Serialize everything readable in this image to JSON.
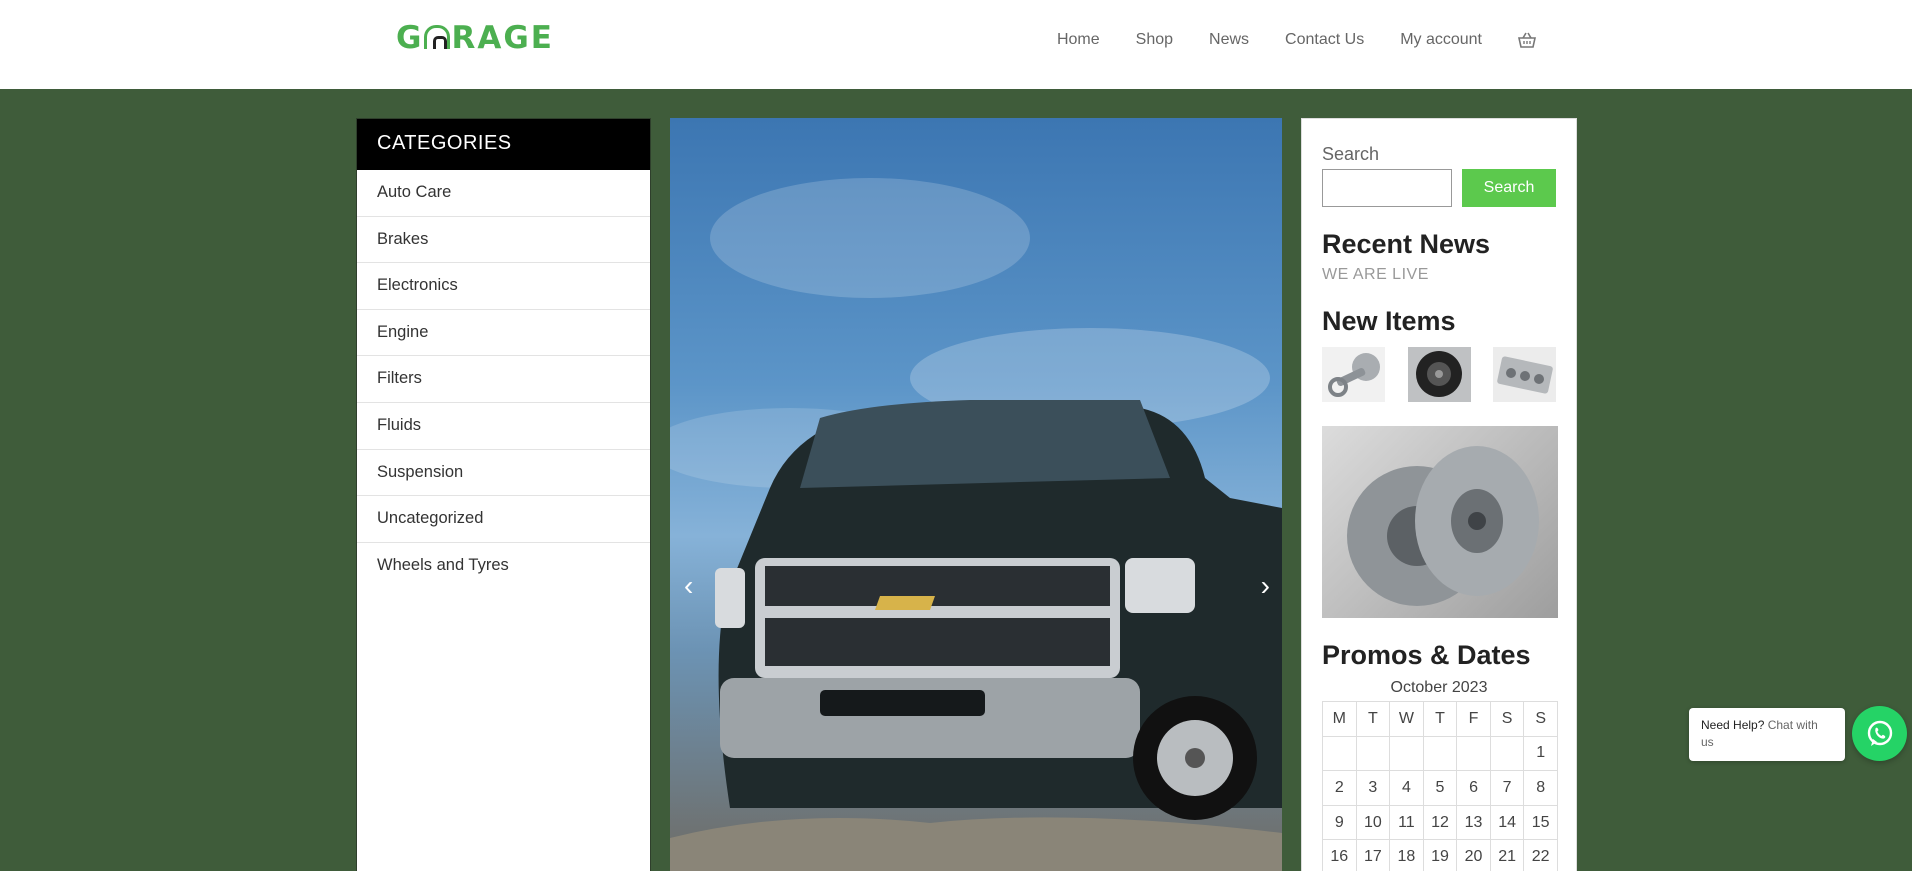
{
  "header": {
    "logo_text": "GARAGE",
    "nav": [
      "Home",
      "Shop",
      "News",
      "Contact Us",
      "My account"
    ],
    "cart_icon": "basket-icon"
  },
  "categories": {
    "title": "CATEGORIES",
    "items": [
      "Auto Care",
      "Brakes",
      "Electronics",
      "Engine",
      "Filters",
      "Fluids",
      "Suspension",
      "Uncategorized",
      "Wheels and Tyres"
    ]
  },
  "slider": {
    "prev_icon": "chevron-left-icon",
    "next_icon": "chevron-right-icon",
    "prev_glyph": "‹",
    "next_glyph": "›"
  },
  "sidebar": {
    "search_label": "Search",
    "search_value": "",
    "search_button": "Search",
    "recent_news_title": "Recent News",
    "recent_news_items": [
      "WE ARE LIVE"
    ],
    "new_items_title": "New Items",
    "promos_title": "Promos & Dates",
    "calendar": {
      "caption": "October 2023",
      "weekdays": [
        "M",
        "T",
        "W",
        "T",
        "F",
        "S",
        "S"
      ],
      "rows": [
        [
          "",
          "",
          "",
          "",
          "",
          "",
          "1"
        ],
        [
          "2",
          "3",
          "4",
          "5",
          "6",
          "7",
          "8"
        ],
        [
          "9",
          "10",
          "11",
          "12",
          "13",
          "14",
          "15"
        ],
        [
          "16",
          "17",
          "18",
          "19",
          "20",
          "21",
          "22"
        ]
      ]
    }
  },
  "chat": {
    "bold": "Need Help?",
    "text": "Chat with us",
    "icon": "whatsapp-icon"
  },
  "colors": {
    "accent": "#5cc94d",
    "background": "#3f5c3a",
    "logo": "#4caf50"
  }
}
